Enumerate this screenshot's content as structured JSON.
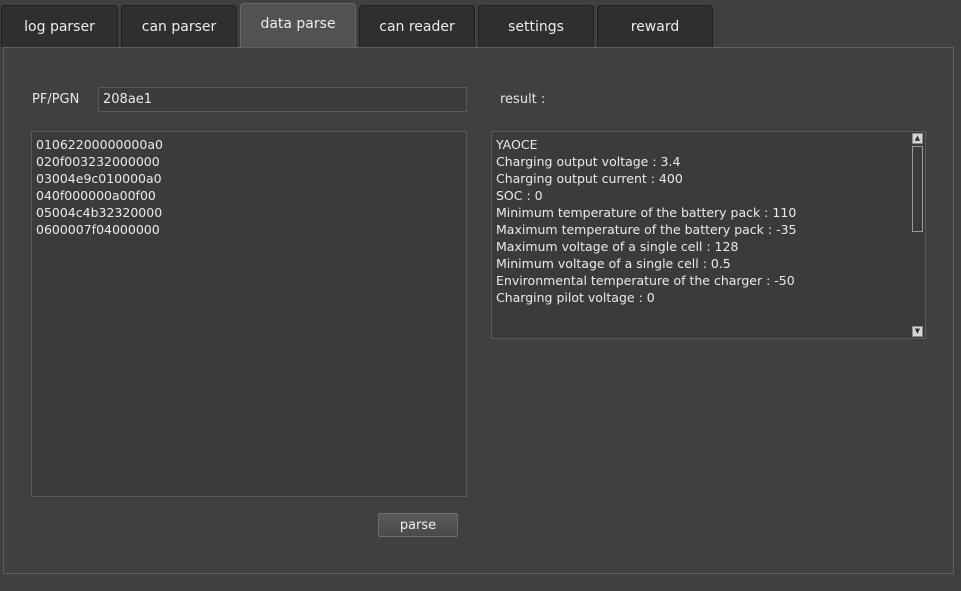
{
  "tabs": [
    {
      "label": "log parser"
    },
    {
      "label": "can parser"
    },
    {
      "label": "data parse"
    },
    {
      "label": "can reader"
    },
    {
      "label": "settings"
    },
    {
      "label": "reward"
    }
  ],
  "active_tab": "data parse",
  "form": {
    "pgn_label": "PF/PGN",
    "pgn_value": "208ae1",
    "result_label": "result :",
    "parse_label": "parse"
  },
  "input_lines": [
    "01062200000000a0",
    "020f003232000000",
    "03004e9c010000a0",
    "040f000000a00f00",
    "05004c4b32320000",
    "0600007f04000000"
  ],
  "result_lines": [
    "YAOCE",
    "",
    "",
    "Charging output voltage : 3.4",
    "Charging output current : 400",
    "SOC : 0",
    "Minimum temperature of the battery pack : 110",
    "Maximum temperature of the battery pack : -35",
    "Maximum voltage of a single cell : 128",
    "Minimum voltage of a single cell : 0.5",
    "Environmental temperature of the charger : -50",
    "Charging pilot voltage : 0"
  ],
  "icons": {
    "scroll_up": "up-arrow-icon",
    "scroll_down": "down-arrow-icon"
  }
}
